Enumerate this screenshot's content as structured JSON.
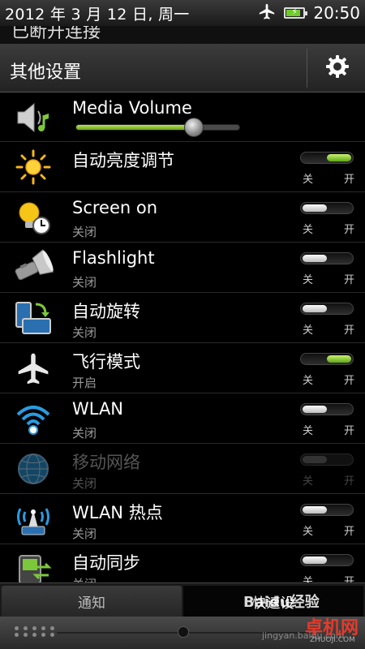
{
  "status_bar": {
    "date": "2012 年 3 月 12 日, 周一",
    "time": "20:50",
    "battery_level": 0.85
  },
  "pulldown_partial_text": "已断开连接",
  "header": {
    "title": "其他设置"
  },
  "media_volume": {
    "label": "Media Volume",
    "level": 0.72
  },
  "toggle_labels": {
    "off": "关",
    "on": "开"
  },
  "settings": [
    {
      "icon": "sun-icon",
      "title": "自动亮度调节",
      "subtitle": "",
      "on": true,
      "enabled": true
    },
    {
      "icon": "bulb-clock-icon",
      "title": "Screen on",
      "subtitle": "关闭",
      "on": false,
      "enabled": true
    },
    {
      "icon": "flashlight-icon",
      "title": "Flashlight",
      "subtitle": "关闭",
      "on": false,
      "enabled": true
    },
    {
      "icon": "rotate-icon",
      "title": "自动旋转",
      "subtitle": "关闭",
      "on": false,
      "enabled": true
    },
    {
      "icon": "airplane-icon",
      "title": "飞行模式",
      "subtitle": "开启",
      "on": true,
      "enabled": true
    },
    {
      "icon": "wifi-icon",
      "title": "WLAN",
      "subtitle": "关闭",
      "on": false,
      "enabled": true
    },
    {
      "icon": "globe-icon",
      "title": "移动网络",
      "subtitle": "关闭",
      "on": false,
      "enabled": false
    },
    {
      "icon": "hotspot-icon",
      "title": "WLAN 热点",
      "subtitle": "关闭",
      "on": false,
      "enabled": true
    },
    {
      "icon": "sync-icon",
      "title": "自动同步",
      "subtitle": "关闭",
      "on": false,
      "enabled": true
    }
  ],
  "tabs": {
    "notifications": "通知",
    "quick_settings": "快速设"
  },
  "watermarks": {
    "baidu": "Baidu经验",
    "baidu_url": "jingyan.baidu.com",
    "zhuoji": "卓机网",
    "zhuoji_url": "ZHUOJI.COM"
  },
  "colors": {
    "toggle_on": "#6ecb2b",
    "toggle_off": "#d9d9d9",
    "accent_blue": "#2a9be0"
  }
}
